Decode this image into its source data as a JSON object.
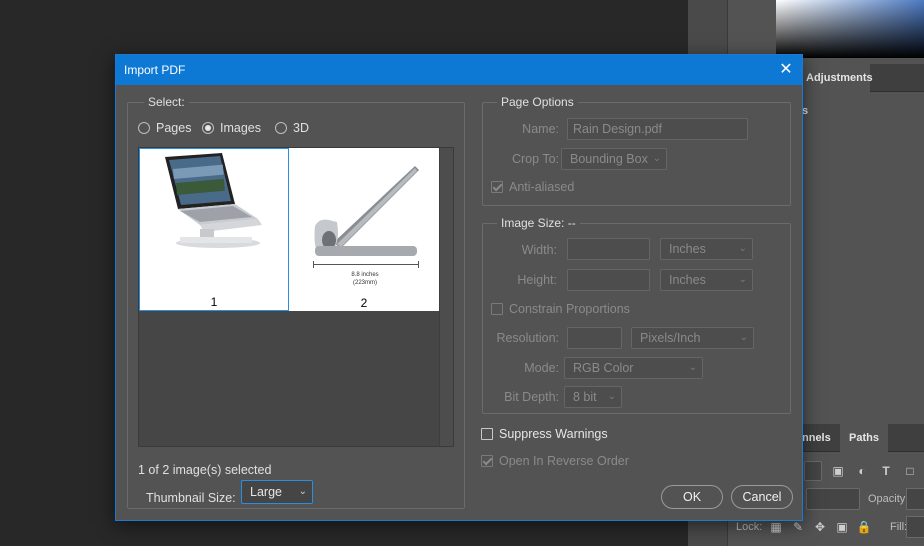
{
  "dialog": {
    "title": "Import PDF",
    "select": {
      "legend": "Select:",
      "options": [
        "Pages",
        "Images",
        "3D"
      ],
      "selected": "Images",
      "thumbnails": [
        {
          "label": "1",
          "selected": true
        },
        {
          "label": "2",
          "selected": false,
          "caption_line1": "8.8 inches",
          "caption_line2": "(223mm)"
        }
      ],
      "status": "1 of 2 image(s) selected",
      "thumbnail_size_label": "Thumbnail Size:",
      "thumbnail_size_value": "Large"
    },
    "page_options": {
      "legend": "Page Options",
      "name_label": "Name:",
      "name_value": "Rain Design.pdf",
      "crop_label": "Crop To:",
      "crop_value": "Bounding Box",
      "anti_aliased_label": "Anti-aliased",
      "anti_aliased_checked": true
    },
    "image_size": {
      "legend": "Image Size: --",
      "width_label": "Width:",
      "width_unit": "Inches",
      "height_label": "Height:",
      "height_unit": "Inches",
      "constrain_label": "Constrain Proportions",
      "resolution_label": "Resolution:",
      "resolution_unit": "Pixels/Inch",
      "mode_label": "Mode:",
      "mode_value": "RGB Color",
      "bit_depth_label": "Bit Depth:",
      "bit_depth_value": "8 bit"
    },
    "suppress_warnings_label": "Suppress Warnings",
    "suppress_warnings_checked": false,
    "reverse_order_label": "Open In Reverse Order",
    "reverse_order_checked": true,
    "ok_label": "OK",
    "cancel_label": "Cancel"
  },
  "background": {
    "adjustments_tab": "Adjustments",
    "adjustments_fragment": "s",
    "channels_tab": "nnels",
    "paths_tab": "Paths",
    "opacity_label": "Opacity:",
    "fill_label": "Fill:",
    "lock_label": "Lock:"
  },
  "colors": {
    "titlebar": "#0e78d5",
    "dialog_bg": "#535353",
    "accent": "#2a8fe0"
  }
}
